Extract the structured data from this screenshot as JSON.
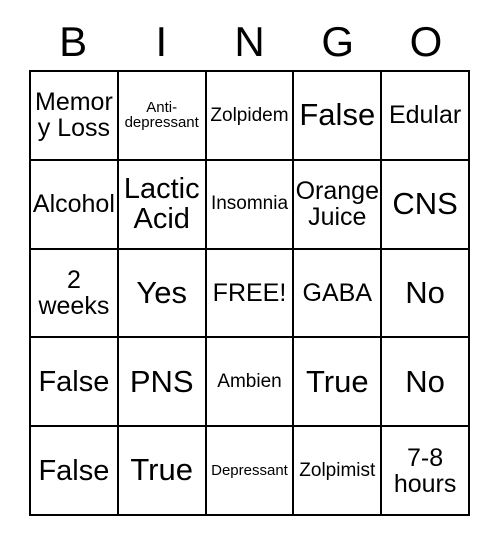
{
  "card": {
    "header_letters": [
      "B",
      "I",
      "N",
      "G",
      "O"
    ],
    "rows": [
      [
        {
          "text": "Memory Loss",
          "size": "md"
        },
        {
          "text": "Anti-depressant",
          "size": "xs"
        },
        {
          "text": "Zolpidem",
          "size": "sm"
        },
        {
          "text": "False",
          "size": "xl"
        },
        {
          "text": "Edular",
          "size": "md"
        }
      ],
      [
        {
          "text": "Alcohol",
          "size": "md"
        },
        {
          "text": "Lactic Acid",
          "size": "lg"
        },
        {
          "text": "Insomnia",
          "size": "sm"
        },
        {
          "text": "Orange Juice",
          "size": "md"
        },
        {
          "text": "CNS",
          "size": "xl"
        }
      ],
      [
        {
          "text": "2 weeks",
          "size": "md"
        },
        {
          "text": "Yes",
          "size": "xl"
        },
        {
          "text": "FREE!",
          "size": "md"
        },
        {
          "text": "GABA",
          "size": "md"
        },
        {
          "text": "No",
          "size": "xl"
        }
      ],
      [
        {
          "text": "False",
          "size": "lg"
        },
        {
          "text": "PNS",
          "size": "xl"
        },
        {
          "text": "Ambien",
          "size": "sm"
        },
        {
          "text": "True",
          "size": "xl"
        },
        {
          "text": "No",
          "size": "xl"
        }
      ],
      [
        {
          "text": "False",
          "size": "lg"
        },
        {
          "text": "True",
          "size": "xl"
        },
        {
          "text": "Depressant",
          "size": "xs"
        },
        {
          "text": "Zolpimist",
          "size": "sm"
        },
        {
          "text": "7-8 hours",
          "size": "md"
        }
      ]
    ],
    "free_space": "FREE!",
    "colors": {
      "border": "#000000",
      "background": "#ffffff",
      "text": "#000000"
    }
  }
}
